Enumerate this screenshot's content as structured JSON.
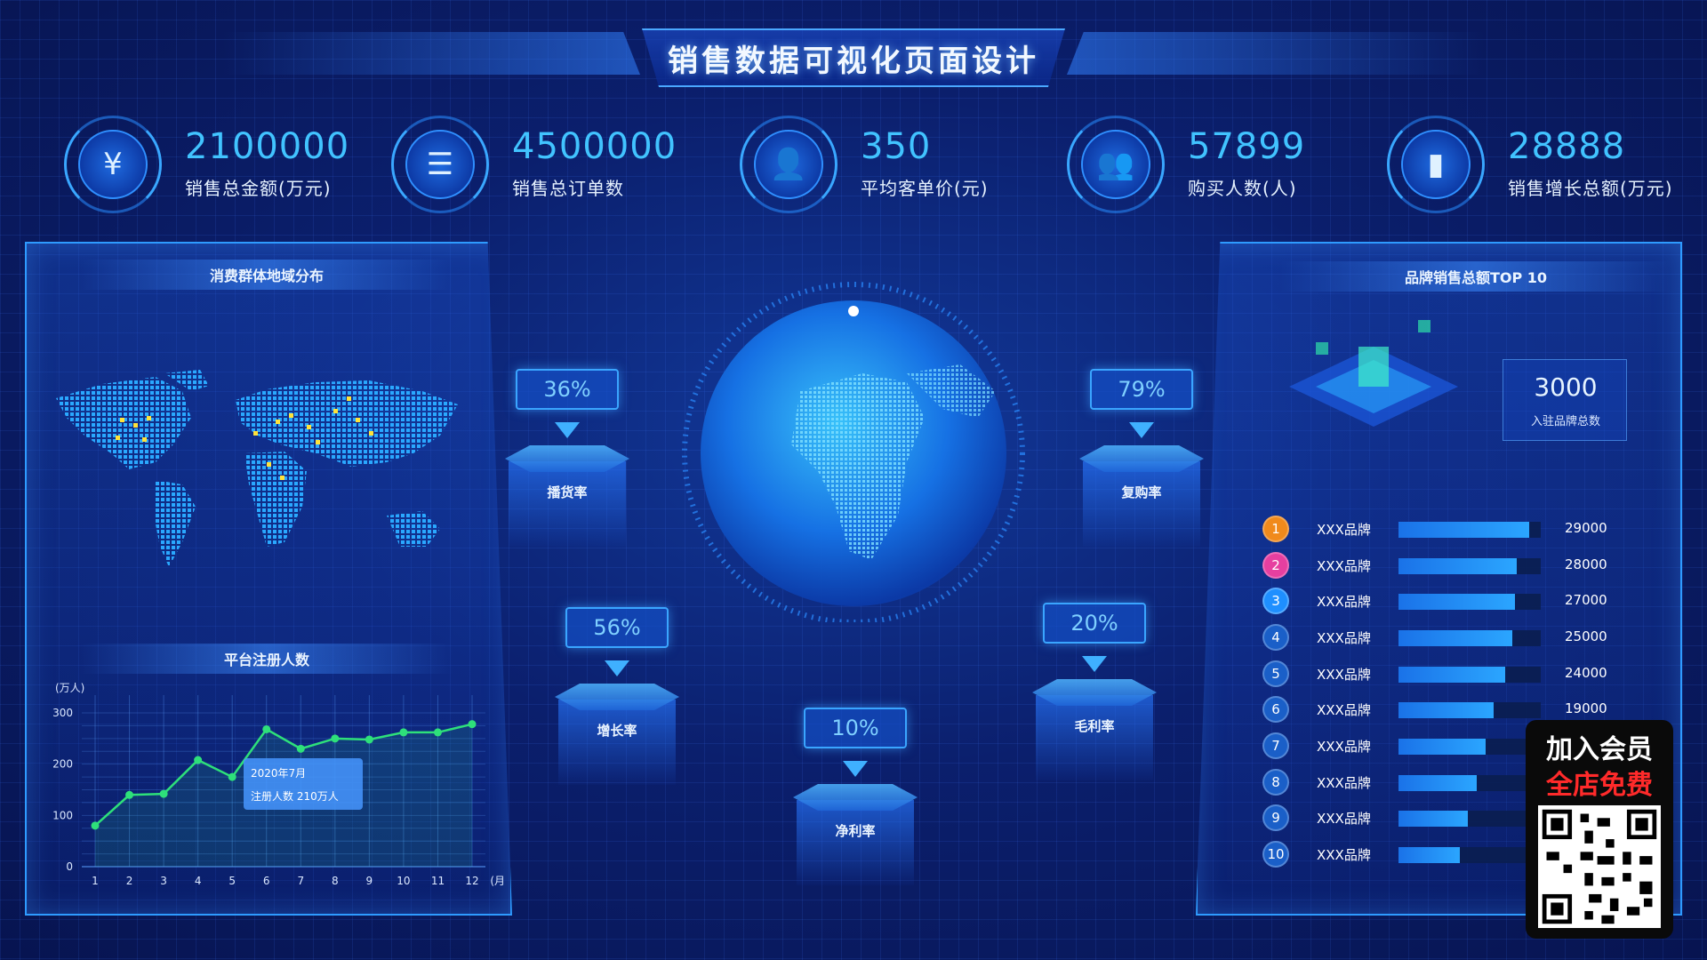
{
  "header": {
    "title": "销售数据可视化页面设计"
  },
  "stats": [
    {
      "value": "2100000",
      "label": "销售总金额(万元)",
      "icon": "yen-shield-icon"
    },
    {
      "value": "4500000",
      "label": "销售总订单数",
      "icon": "clipboard-icon"
    },
    {
      "value": "350",
      "label": "平均客单价(元)",
      "icon": "user-icon"
    },
    {
      "value": "57899",
      "label": "购买人数(人)",
      "icon": "users-icon"
    },
    {
      "value": "28888",
      "label": "销售增长总额(万元)",
      "icon": "bar-chart-icon"
    }
  ],
  "left_panel": {
    "map_title": "消费群体地域分布",
    "chart_title": "平台注册人数",
    "tooltip": {
      "line1": "2020年7月",
      "line2": "注册人数  210万人"
    }
  },
  "metrics": [
    {
      "percent": "36%",
      "label": "播货率"
    },
    {
      "percent": "79%",
      "label": "复购率"
    },
    {
      "percent": "56%",
      "label": "增长率"
    },
    {
      "percent": "20%",
      "label": "毛利率"
    },
    {
      "percent": "10%",
      "label": "净利率"
    }
  ],
  "right_panel": {
    "title": "品牌销售总额TOP 10",
    "total_value": "3000",
    "total_label": "入驻品牌总数",
    "brands": [
      {
        "rank": "1",
        "name": "XXX品牌",
        "value": "29000",
        "fill": 0.92,
        "color": "#f08a1c"
      },
      {
        "rank": "2",
        "name": "XXX品牌",
        "value": "28000",
        "fill": 0.83,
        "color": "#e63fa0"
      },
      {
        "rank": "3",
        "name": "XXX品牌",
        "value": "27000",
        "fill": 0.82,
        "color": "#1e8fff"
      },
      {
        "rank": "4",
        "name": "XXX品牌",
        "value": "25000",
        "fill": 0.8,
        "color": "#1a5fc8"
      },
      {
        "rank": "5",
        "name": "XXX品牌",
        "value": "24000",
        "fill": 0.75,
        "color": "#1a5fc8"
      },
      {
        "rank": "6",
        "name": "XXX品牌",
        "value": "19000",
        "fill": 0.67,
        "color": "#1a5fc8"
      },
      {
        "rank": "7",
        "name": "XXX品牌",
        "value": "",
        "fill": 0.61,
        "color": "#1a5fc8"
      },
      {
        "rank": "8",
        "name": "XXX品牌",
        "value": "",
        "fill": 0.55,
        "color": "#1a5fc8"
      },
      {
        "rank": "9",
        "name": "XXX品牌",
        "value": "",
        "fill": 0.49,
        "color": "#1a5fc8"
      },
      {
        "rank": "10",
        "name": "XXX品牌",
        "value": "",
        "fill": 0.43,
        "color": "#1a5fc8"
      }
    ]
  },
  "promo": {
    "line1": "加入会员",
    "line2": "全店免费"
  },
  "chart_data": {
    "type": "line",
    "title": "平台注册人数",
    "y_unit": "(万人)",
    "x_unit": "(月)",
    "x": [
      "1",
      "2",
      "3",
      "4",
      "5",
      "6",
      "7",
      "8",
      "9",
      "10",
      "11",
      "12"
    ],
    "y": [
      80,
      140,
      142,
      208,
      175,
      268,
      230,
      250,
      248,
      262,
      262,
      278
    ],
    "yticks": [
      "0",
      "100",
      "200",
      "300"
    ],
    "ylim": [
      0,
      300
    ],
    "color": "#2ee07a",
    "grid": true
  }
}
